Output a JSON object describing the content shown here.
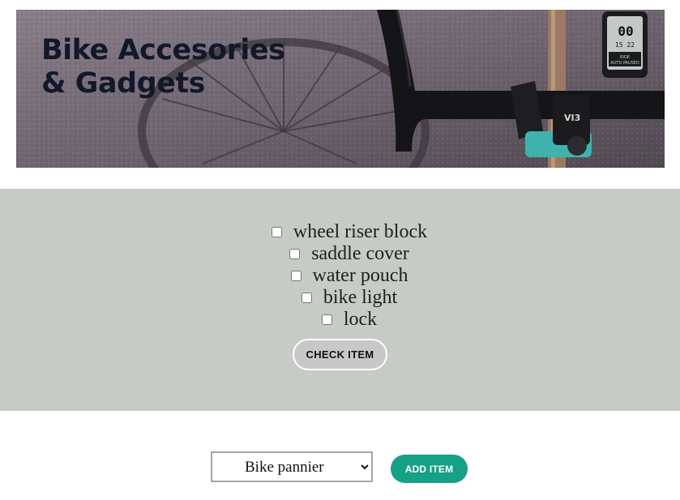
{
  "banner": {
    "title_line1": "Bike Accesories",
    "title_line2": "& Gadgets",
    "gadget_brand": "VI3",
    "computer_readout": "00",
    "computer_small": "15   22",
    "computer_status": "RIDE\nAUTO PAUSED"
  },
  "checklist": {
    "items": [
      {
        "label": "wheel riser block",
        "checked": false
      },
      {
        "label": "saddle cover",
        "checked": false
      },
      {
        "label": "water pouch",
        "checked": false
      },
      {
        "label": "bike light",
        "checked": false
      },
      {
        "label": "lock",
        "checked": false
      }
    ],
    "check_button_label": "CHECK ITEM"
  },
  "add_row": {
    "selected_option": "Bike pannier",
    "add_button_label": "ADD ITEM"
  },
  "colors": {
    "panel_bg": "#c6cbc6",
    "add_button": "#16a085",
    "title_text": "#12182a"
  }
}
